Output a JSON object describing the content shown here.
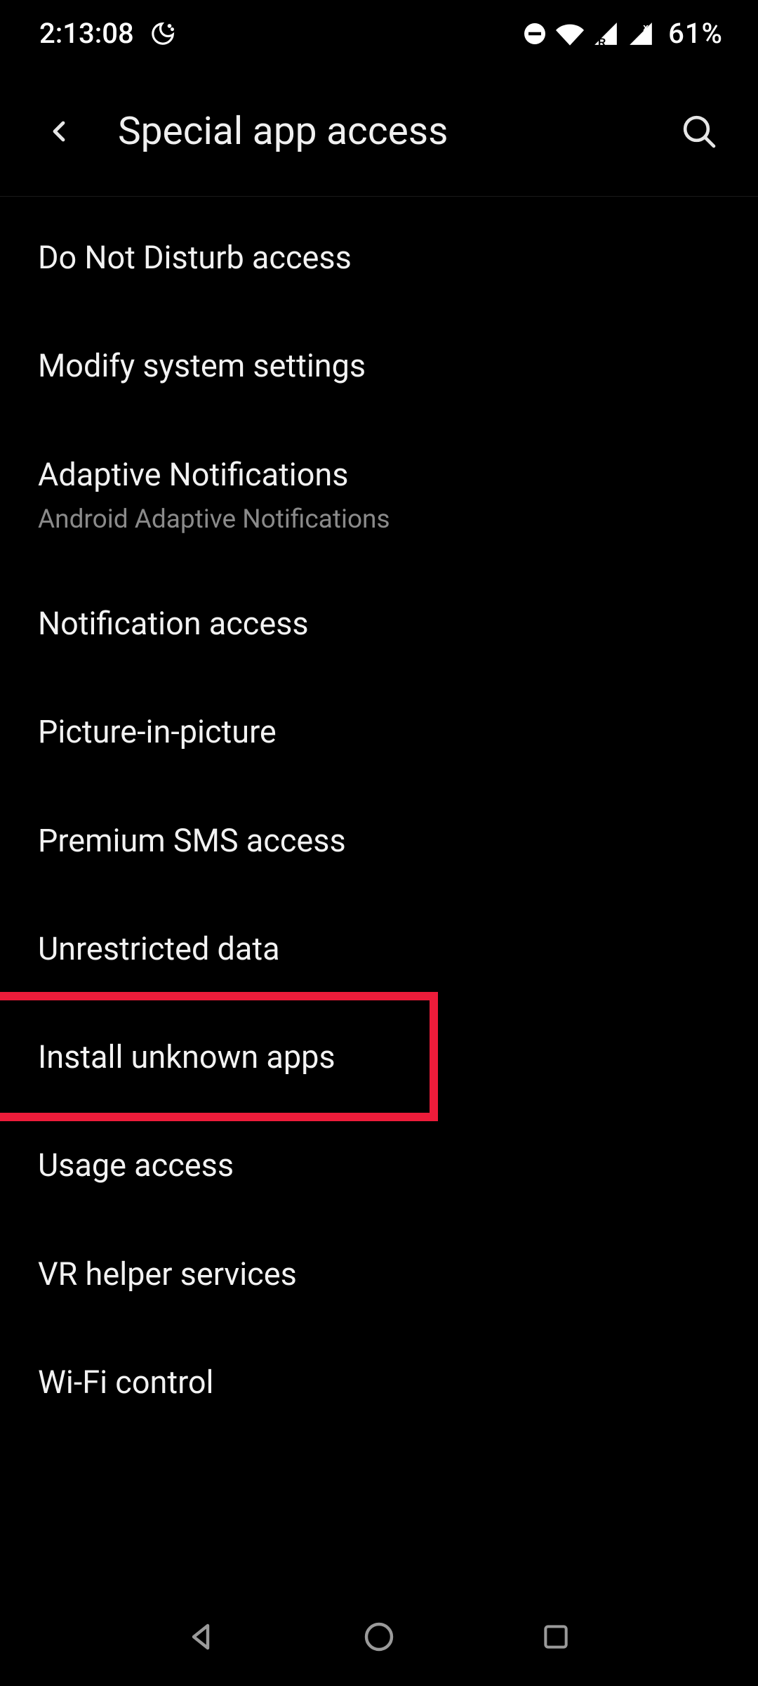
{
  "status": {
    "time": "2:13:08",
    "battery": "61%"
  },
  "appbar": {
    "title": "Special app access"
  },
  "list": [
    {
      "title": "Do Not Disturb access"
    },
    {
      "title": "Modify system settings"
    },
    {
      "title": "Adaptive Notifications",
      "subtitle": "Android Adaptive Notifications"
    },
    {
      "title": "Notification access"
    },
    {
      "title": "Picture-in-picture"
    },
    {
      "title": "Premium SMS access"
    },
    {
      "title": "Unrestricted data"
    },
    {
      "title": "Install unknown apps"
    },
    {
      "title": "Usage access"
    },
    {
      "title": "VR helper services"
    },
    {
      "title": "Wi-Fi control"
    }
  ],
  "highlight_index": 7
}
